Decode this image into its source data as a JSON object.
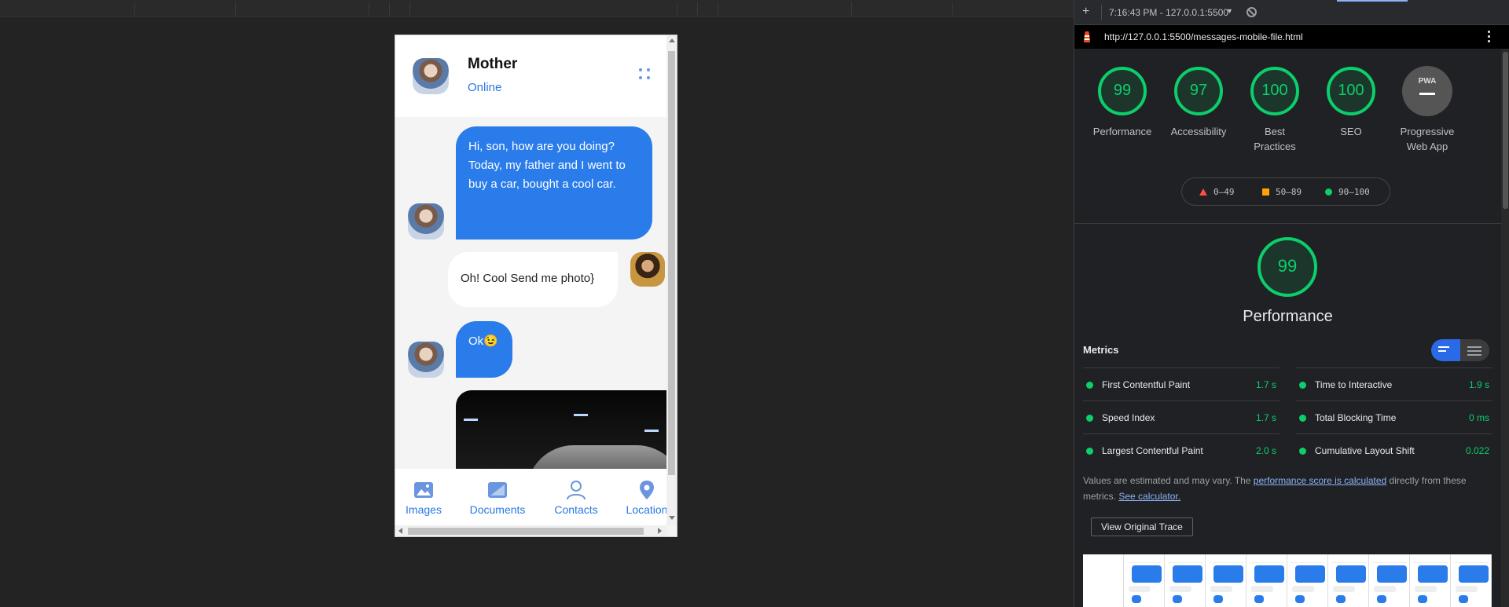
{
  "chat": {
    "contact_name": "Mother",
    "contact_status": "Online",
    "messages": [
      {
        "from": "Mother",
        "text": "Hi, son, how are you doing? Today, my father and I went to buy a car, bought a cool car."
      },
      {
        "from": "Son",
        "text": "Oh! Cool Send me photo}"
      },
      {
        "from": "Mother",
        "text": "Ok😉"
      }
    ],
    "nav": [
      "Images",
      "Documents",
      "Contacts",
      "Location"
    ]
  },
  "devtools": {
    "session": "7:16:43 PM - 127.0.0.1:5500",
    "url": "http://127.0.0.1:5500/messages-mobile-file.html",
    "categories": [
      {
        "score": "99",
        "label": "Performance"
      },
      {
        "score": "97",
        "label": "Accessibility"
      },
      {
        "score": "100",
        "label": "Best Practices"
      },
      {
        "score": "100",
        "label": "SEO"
      }
    ],
    "pwa": {
      "badge": "PWA",
      "label": "Progressive Web App"
    },
    "legend": [
      "0–49",
      "50–89",
      "90–100"
    ],
    "performance": {
      "score": "99",
      "title": "Performance"
    },
    "metrics_heading": "Metrics",
    "metrics": [
      {
        "name": "First Contentful Paint",
        "value": "1.7 s"
      },
      {
        "name": "Time to Interactive",
        "value": "1.9 s"
      },
      {
        "name": "Speed Index",
        "value": "1.7 s"
      },
      {
        "name": "Total Blocking Time",
        "value": "0 ms"
      },
      {
        "name": "Largest Contentful Paint",
        "value": "2.0 s"
      },
      {
        "name": "Cumulative Layout Shift",
        "value": "0.022"
      }
    ],
    "note": {
      "prefix": "Values are estimated and may vary. The ",
      "link1": "performance score is calculated",
      "middle": " directly from these metrics. ",
      "link2": "See calculator."
    },
    "trace_button": "View Original Trace"
  },
  "colors": {
    "accent": "#2a7cea",
    "pass": "#0cce6b",
    "average": "#ffa400",
    "fail": "#ff4e42"
  }
}
